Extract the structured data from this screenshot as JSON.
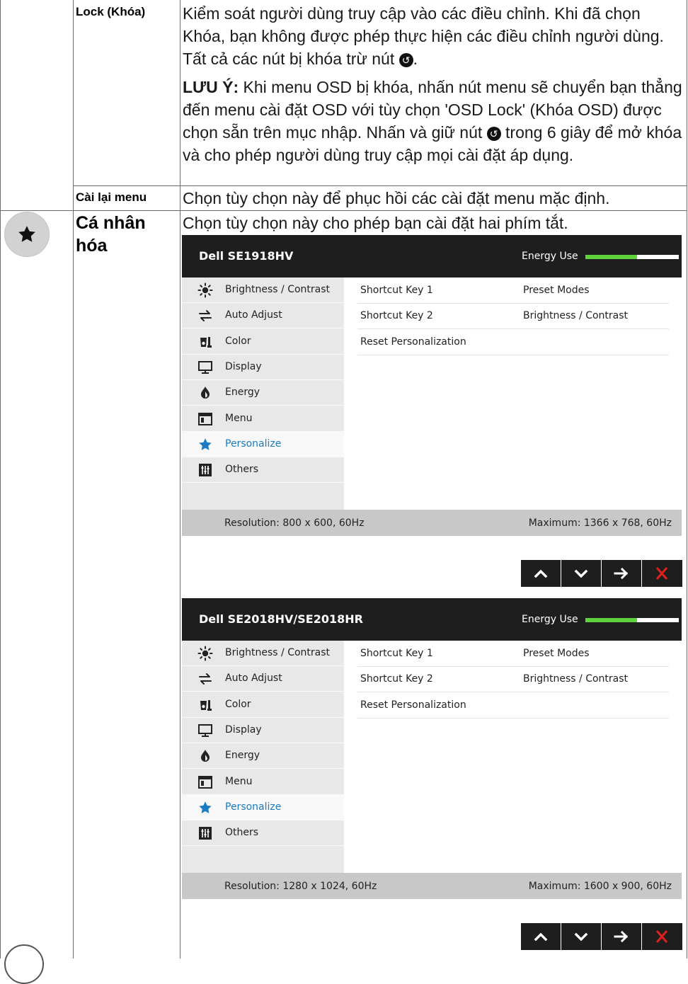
{
  "rows": {
    "lock": {
      "label": "Lock (Khóa)",
      "desc_p1_before": "Kiểm soát người dùng truy cập vào các điều chỉnh. Khi đã chọn Khóa, bạn không được phép thực hiện các điều chỉnh người dùng. Tất cả các nút bị khóa trừ nút ",
      "desc_p1_after": ".",
      "note_label": "LƯU Ý:",
      "note_before": " Khi menu OSD bị khóa, nhấn nút menu sẽ chuyển bạn thẳng đến menu cài đặt OSD với tùy chọn 'OSD Lock' (Khóa OSD) được chọn sẵn trên mục nhập. Nhấn và giữ nút ",
      "note_after": " trong 6 giây để mở khóa và cho phép người dùng truy cập mọi cài đặt áp dụng."
    },
    "reset": {
      "label": "Cài lại menu",
      "desc": "Chọn tùy chọn này để phục hồi các cài đặt menu mặc định."
    },
    "personalize": {
      "label": "Cá nhân hóa",
      "desc": "Chọn tùy chọn này cho phép bạn cài đặt hai phím tắt."
    }
  },
  "back_icon_glyph": "↺",
  "osd_menu_items": [
    {
      "label": "Brightness / Contrast",
      "icon": "brightness-icon"
    },
    {
      "label": "Auto Adjust",
      "icon": "auto-adjust-icon"
    },
    {
      "label": "Color",
      "icon": "color-icon"
    },
    {
      "label": "Display",
      "icon": "display-icon"
    },
    {
      "label": "Energy",
      "icon": "energy-icon"
    },
    {
      "label": "Menu",
      "icon": "menu-icon"
    },
    {
      "label": "Personalize",
      "icon": "star-icon"
    },
    {
      "label": "Others",
      "icon": "others-icon"
    }
  ],
  "osd_panel_rows": [
    {
      "c1": "Shortcut Key 1",
      "c2": "Preset Modes"
    },
    {
      "c1": "Shortcut Key 2",
      "c2": "Brightness / Contrast"
    },
    {
      "c1": "Reset Personalization",
      "c2": ""
    }
  ],
  "osds": [
    {
      "title": "Dell SE1918HV",
      "energy_label": "Energy Use",
      "energy_level": 0.55,
      "resolution": "Resolution: 800 x 600, 60Hz",
      "maximum": "Maximum: 1366 x 768, 60Hz"
    },
    {
      "title": "Dell SE2018HV/SE2018HR",
      "energy_label": "Energy Use",
      "energy_level": 0.55,
      "resolution": "Resolution: 1280 x 1024, 60Hz",
      "maximum": "Maximum: 1600 x 900, 60Hz"
    }
  ],
  "colors": {
    "osd_header": "#1e1e1e",
    "energy_green": "#5fd33c",
    "selected_text": "#1a7cc2",
    "close_red": "#e0201d"
  }
}
